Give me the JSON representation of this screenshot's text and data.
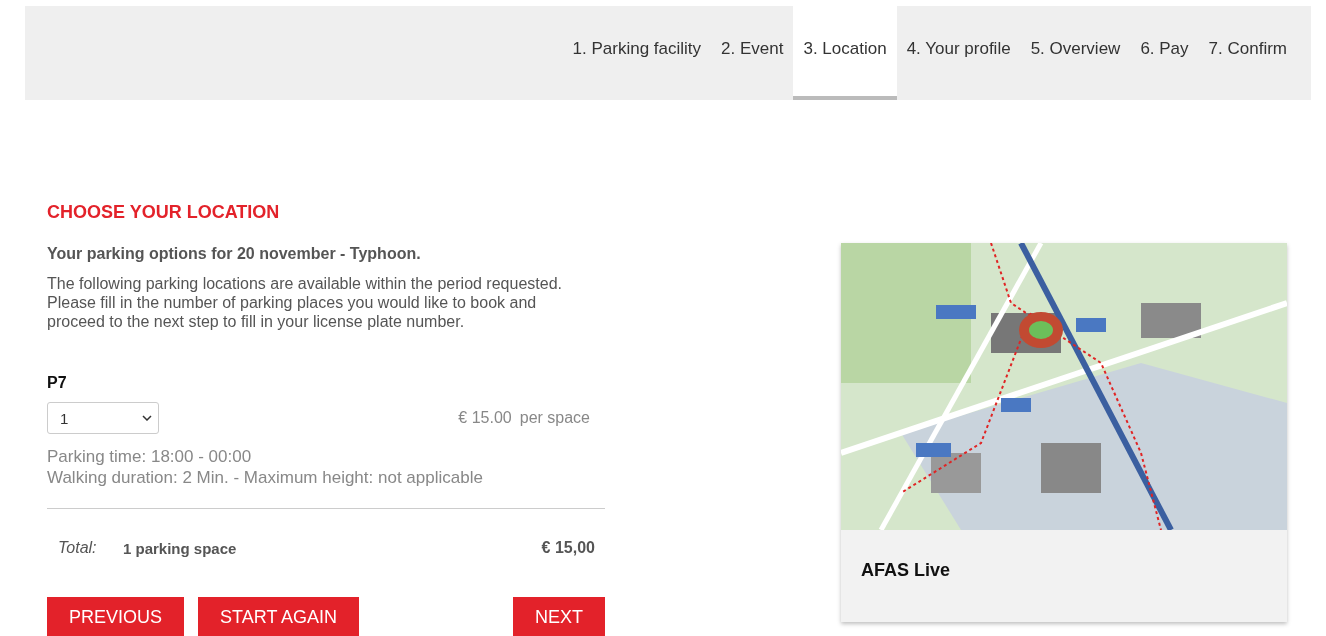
{
  "steps": [
    {
      "label": "1. Parking facility",
      "selected": false
    },
    {
      "label": "2. Event",
      "selected": false
    },
    {
      "label": "3. Location",
      "selected": true
    },
    {
      "label": "4. Your profile",
      "selected": false
    },
    {
      "label": "5. Overview",
      "selected": false
    },
    {
      "label": "6. Pay",
      "selected": false
    },
    {
      "label": "7. Confirm",
      "selected": false
    }
  ],
  "heading": "CHOOSE YOUR LOCATION",
  "subtitle": "Your parking options for 20 november - Typhoon.",
  "intro": "The following parking locations are available within the period requested. Please fill in the number of parking places you would like to book and proceed to the next step to fill in your license plate number.",
  "facility": {
    "name": "P7",
    "quantity": "1",
    "price": "€ 15.00",
    "price_unit": "per space",
    "details": [
      "Parking time: 18:00 - 00:00",
      "Walking duration: 2 Min. - Maximum height: not applicable"
    ]
  },
  "total": {
    "label": "Total:",
    "description": "1 parking space",
    "amount": "€ 15,00"
  },
  "buttons": {
    "previous": "PREVIOUS",
    "start_again": "START AGAIN",
    "next": "NEXT"
  },
  "location_card": {
    "title": "AFAS Live"
  }
}
